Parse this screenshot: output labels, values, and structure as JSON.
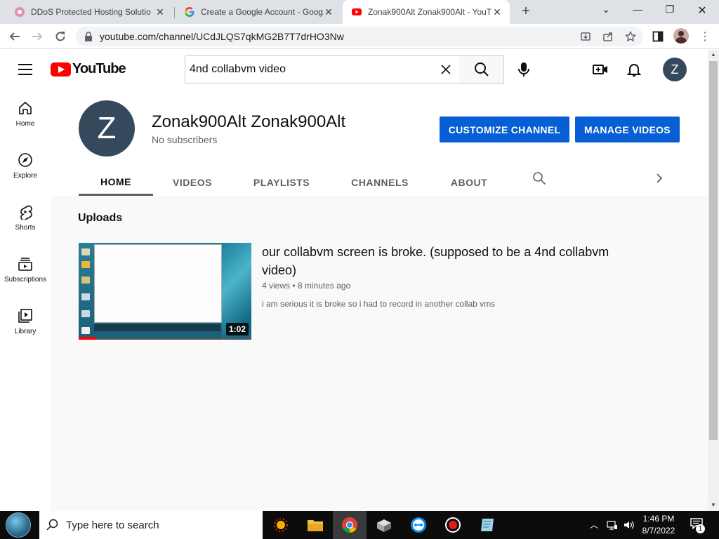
{
  "browser": {
    "tabs": [
      {
        "title": "DDoS Protected Hosting Solutio",
        "icon": "ddos-favicon"
      },
      {
        "title": "Create a Google Account - Goog",
        "icon": "google-favicon"
      },
      {
        "title": "Zonak900Alt Zonak900Alt - YouT",
        "icon": "youtube-favicon",
        "active": true
      }
    ],
    "url": "youtube.com/channel/UCdJLQS7qkMG2B7T7drHO3Nw"
  },
  "youtube": {
    "logo_text": "YouTube",
    "search_value": "4nd collabvm video",
    "avatar_letter": "Z",
    "sidebar": [
      {
        "label": "Home",
        "icon": "home-icon"
      },
      {
        "label": "Explore",
        "icon": "compass-icon"
      },
      {
        "label": "Shorts",
        "icon": "shorts-icon"
      },
      {
        "label": "Subscriptions",
        "icon": "subscriptions-icon"
      },
      {
        "label": "Library",
        "icon": "library-icon"
      }
    ],
    "channel": {
      "avatar_letter": "Z",
      "name": "Zonak900Alt Zonak900Alt",
      "subscribers": "No subscribers",
      "customize_label": "CUSTOMIZE CHANNEL",
      "manage_label": "MANAGE VIDEOS",
      "tabs": [
        "HOME",
        "VIDEOS",
        "PLAYLISTS",
        "CHANNELS",
        "ABOUT"
      ],
      "active_tab": "HOME"
    },
    "uploads": {
      "heading": "Uploads",
      "video": {
        "title": "our collabvm screen is broke. (supposed to be a 4nd collabvm video)",
        "meta": "4 views • 8 minutes ago",
        "description": "i am serious it is broke so i had to record in another collab vms",
        "duration": "1:02",
        "watched_fraction": 0.1
      }
    }
  },
  "taskbar": {
    "search_placeholder": "Type here to search",
    "time": "1:46 PM",
    "date": "8/7/2022",
    "notification_count": "1"
  }
}
